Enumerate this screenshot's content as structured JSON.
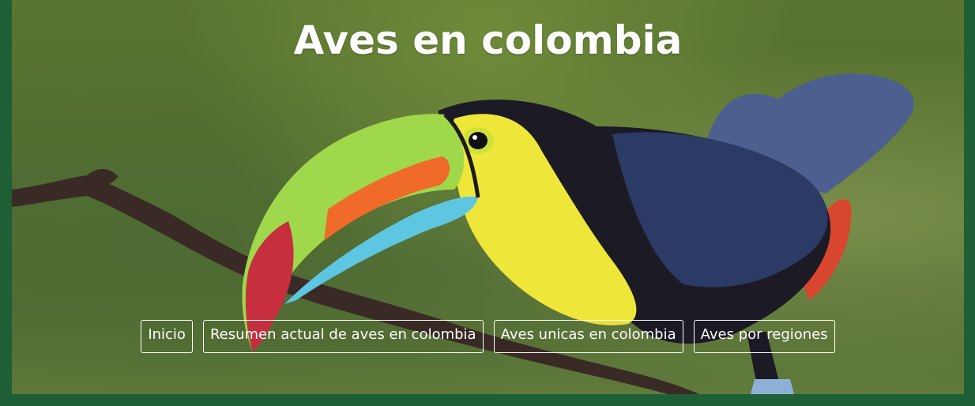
{
  "header": {
    "title": "Aves en colombia"
  },
  "hero_image": {
    "subject": "keel-billed toucan on a branch"
  },
  "nav": {
    "items": [
      {
        "label": "Inicio"
      },
      {
        "label": "Resumen actual de aves en colombia"
      },
      {
        "label": "Aves unicas en colombia"
      },
      {
        "label": "Aves por regiones"
      }
    ]
  },
  "colors": {
    "frame": "#1e5f35",
    "title": "#ffffff",
    "nav_border": "#ffffff"
  }
}
